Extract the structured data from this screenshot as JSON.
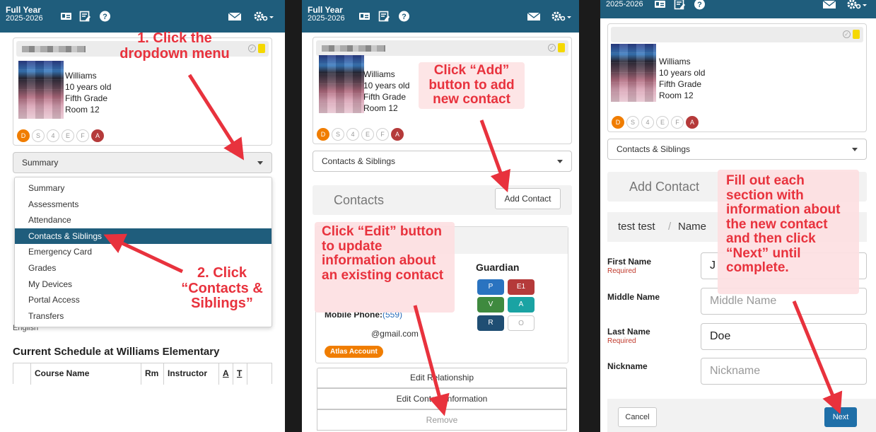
{
  "colors": {
    "header": "#1f5d7c",
    "accent_red": "#e8323d",
    "orange": "#f07d00"
  },
  "header": {
    "title": "Full Year",
    "years": "2025-2026"
  },
  "student": {
    "name": "Williams",
    "age": "10 years old",
    "grade": "Fifth Grade",
    "room": "Room 12"
  },
  "badges": [
    "D",
    "S",
    "4",
    "E",
    "F",
    "A"
  ],
  "panel1": {
    "select_value": "Summary",
    "menu": [
      "Summary",
      "Assessments",
      "Attendance",
      "Contacts & Siblings",
      "Emergency Card",
      "Grades",
      "My Devices",
      "Portal Access",
      "Transfers"
    ],
    "behind_text": "English",
    "schedule_title": "Current Schedule at Williams Elementary",
    "schedule_cols": [
      "Course Name",
      "Rm",
      "Instructor",
      "A",
      "T"
    ],
    "annotation1": "1. Click the dropdown menu",
    "annotation2": "2. Click “Contacts & Siblings”"
  },
  "panel2": {
    "select_value": "Contacts & Siblings",
    "section_title": "Contacts",
    "add_contact": "Add Contact",
    "guardian_title": "Guardian",
    "guardian_badges": [
      "P",
      "E1",
      "V",
      "A",
      "R",
      "O"
    ],
    "mobile_label": "Mobile Phone:",
    "mobile_value": "(559)",
    "email": "@gmail.com",
    "atlas": "Atlas Account",
    "actions": [
      "Edit Relationship",
      "Edit Contact Information",
      "Remove"
    ],
    "annotation_add": "Click “Add” button to add new contact",
    "annotation_edit": "Click “Edit” button to update information about an existing contact"
  },
  "panel3": {
    "select_value": "Contacts & Siblings",
    "add_contact_title": "Add Contact",
    "breadcrumb_name": "test test",
    "breadcrumb_sep": "/",
    "breadcrumb_section": "Name",
    "fields": [
      {
        "label": "First Name",
        "req": "Required",
        "value": "J"
      },
      {
        "label": "Middle Name",
        "req": "",
        "value": "Middle Name"
      },
      {
        "label": "Last Name",
        "req": "Required",
        "value": "Doe"
      },
      {
        "label": "Nickname",
        "req": "",
        "value": "Nickname"
      }
    ],
    "cancel": "Cancel",
    "next": "Next",
    "annotation": "Fill out each section with information about the new contact and then click “Next” until complete."
  }
}
